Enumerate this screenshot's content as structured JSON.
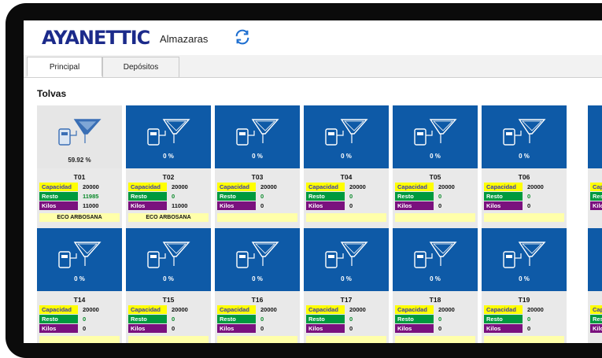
{
  "header": {
    "logo_text": "AYANETTIC",
    "app_name": "Almazaras"
  },
  "tabs": [
    {
      "label": "Principal"
    },
    {
      "label": "Depósitos"
    }
  ],
  "section_title": "Tolvas",
  "labels": {
    "capacidad": "Capacidad",
    "resto": "Resto",
    "kilos": "Kilos"
  },
  "colors": {
    "card_blue": "#0e5aa7",
    "capacidad": "#ffff00",
    "resto": "#009a3e",
    "kilos": "#7a117e"
  },
  "tolvas_row1": [
    {
      "name": "T01",
      "pct": "59.92 %",
      "capacidad": "20000",
      "resto": "11985",
      "kilos": "11000",
      "origin": "ECO ARBOSANA",
      "active": true
    },
    {
      "name": "T02",
      "pct": "0 %",
      "capacidad": "20000",
      "resto": "0",
      "kilos": "11000",
      "origin": "ECO ARBOSANA",
      "active": false
    },
    {
      "name": "T03",
      "pct": "0 %",
      "capacidad": "20000",
      "resto": "0",
      "kilos": "0",
      "origin": "",
      "active": false
    },
    {
      "name": "T04",
      "pct": "0 %",
      "capacidad": "20000",
      "resto": "0",
      "kilos": "0",
      "origin": "",
      "active": false
    },
    {
      "name": "T05",
      "pct": "0 %",
      "capacidad": "20000",
      "resto": "0",
      "kilos": "0",
      "origin": "",
      "active": false
    },
    {
      "name": "T06",
      "pct": "0 %",
      "capacidad": "20000",
      "resto": "0",
      "kilos": "0",
      "origin": "",
      "active": false
    }
  ],
  "tolvas_row2": [
    {
      "name": "T14",
      "pct": "0 %",
      "capacidad": "20000",
      "resto": "0",
      "kilos": "0",
      "origin": ""
    },
    {
      "name": "T15",
      "pct": "0 %",
      "capacidad": "20000",
      "resto": "0",
      "kilos": "0",
      "origin": ""
    },
    {
      "name": "T16",
      "pct": "0 %",
      "capacidad": "20000",
      "resto": "0",
      "kilos": "0",
      "origin": ""
    },
    {
      "name": "T17",
      "pct": "0 %",
      "capacidad": "20000",
      "resto": "0",
      "kilos": "0",
      "origin": ""
    },
    {
      "name": "T18",
      "pct": "0 %",
      "capacidad": "20000",
      "resto": "0",
      "kilos": "0",
      "origin": ""
    },
    {
      "name": "T19",
      "pct": "0 %",
      "capacidad": "20000",
      "resto": "0",
      "kilos": "0",
      "origin": ""
    }
  ],
  "partial_card_labels": {
    "cap": "Cap",
    "rest": "Rest",
    "kilo": "Kilo"
  }
}
